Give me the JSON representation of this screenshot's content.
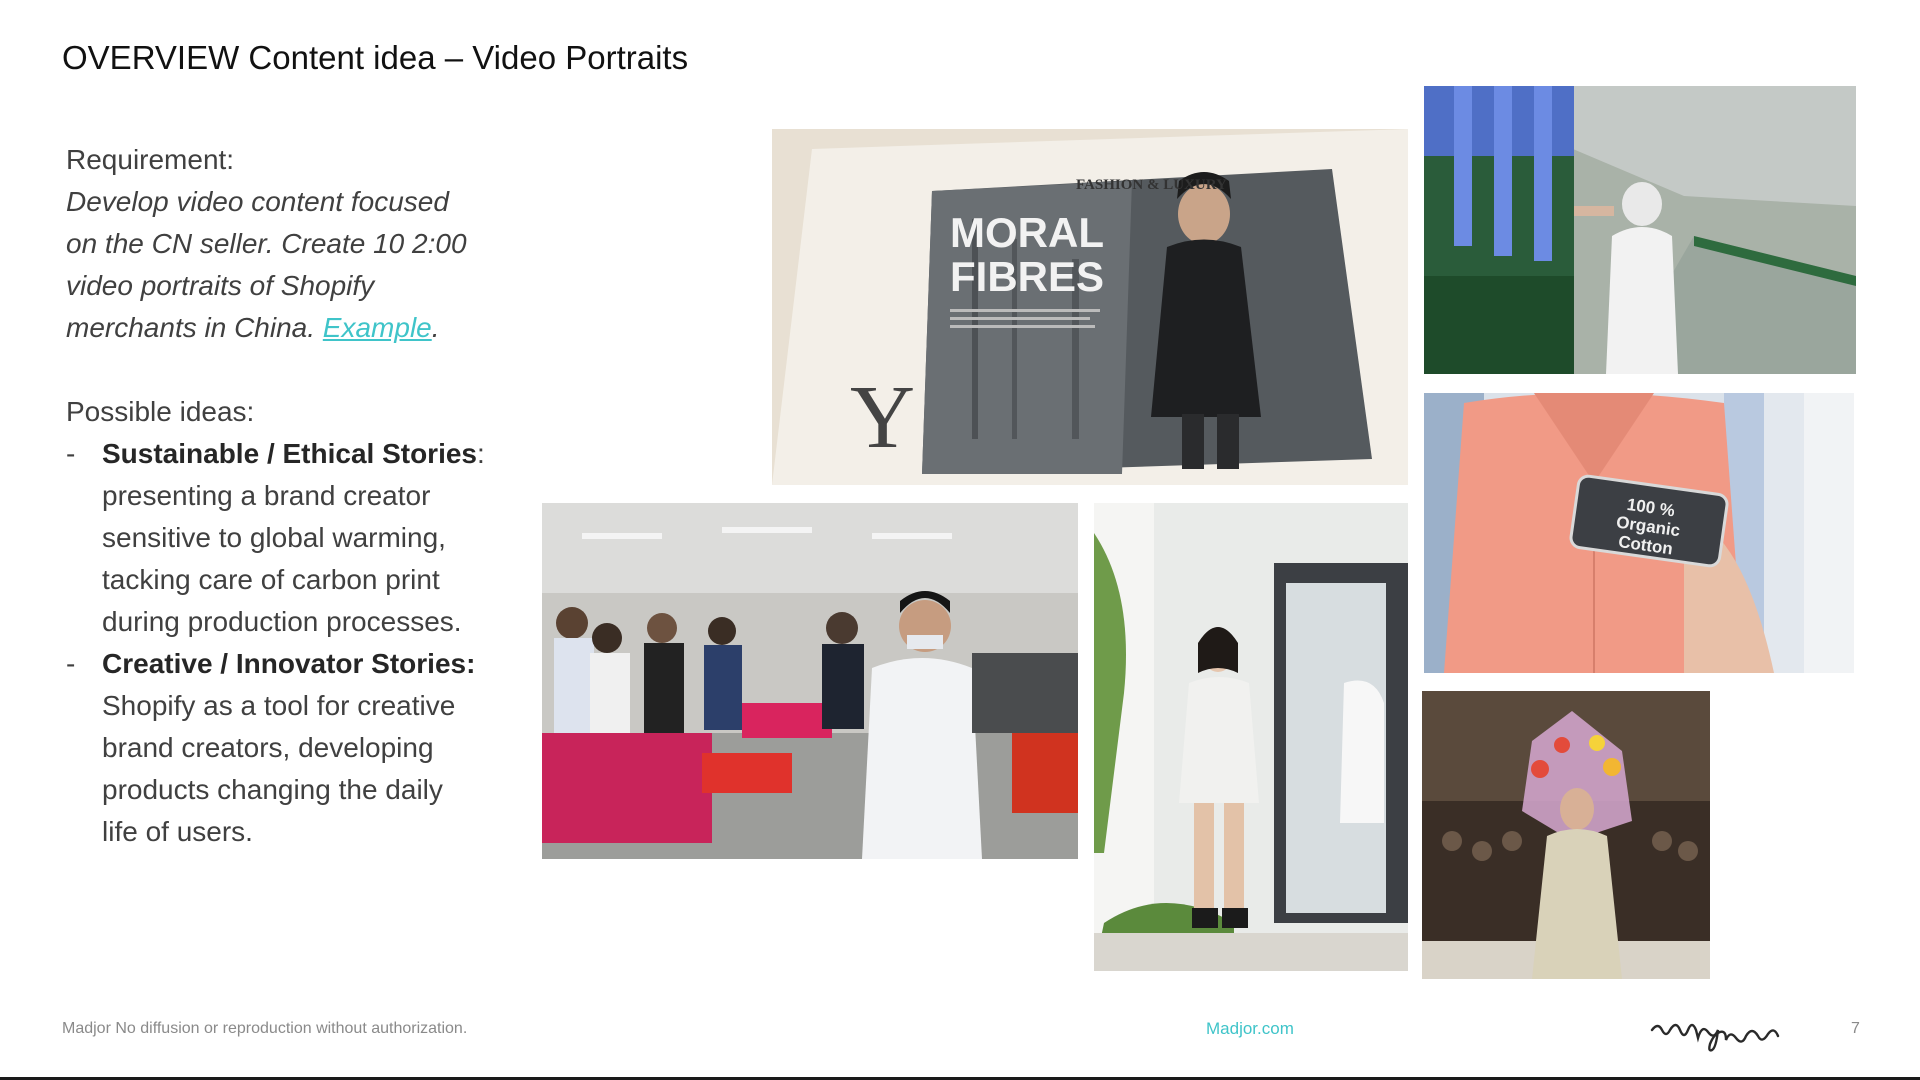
{
  "slide": {
    "title": "OVERVIEW Content idea – Video Portraits",
    "requirement_label": "Requirement:",
    "requirement_text": "Develop video content focused on the CN seller. Create 10 2:00 video portraits of Shopify merchants in China.",
    "example_link": "Example",
    "example_period": ".",
    "ideas_label": "Possible ideas:",
    "ideas": [
      {
        "dash": "-",
        "heading": "Sustainable / Ethical Stories",
        "text": ": presenting a brand creator sensitive to global warming, tacking care of carbon print during production processes."
      },
      {
        "dash": "-",
        "heading": "Creative / Innovator Stories:",
        "text": " Shopify as a tool for creative brand creators, developing products changing the daily life of users."
      }
    ]
  },
  "images": {
    "newspaper": {
      "section": "FASHION & LUXURY",
      "headline_1": "MORAL",
      "headline_2": "FIBRES",
      "dropcap": "Y"
    },
    "tag": {
      "line_1": "100 %",
      "line_2": "Organic",
      "line_3": "Cotton"
    }
  },
  "footer": {
    "disclaimer": "Madjor No diffusion or reproduction without authorization.",
    "site": "Madjor.com",
    "logo_text": "aubignac",
    "page_number": "7"
  },
  "colors": {
    "accent": "#3fc4c9",
    "body_text": "#404040",
    "footer_text": "#8a8a8a"
  }
}
